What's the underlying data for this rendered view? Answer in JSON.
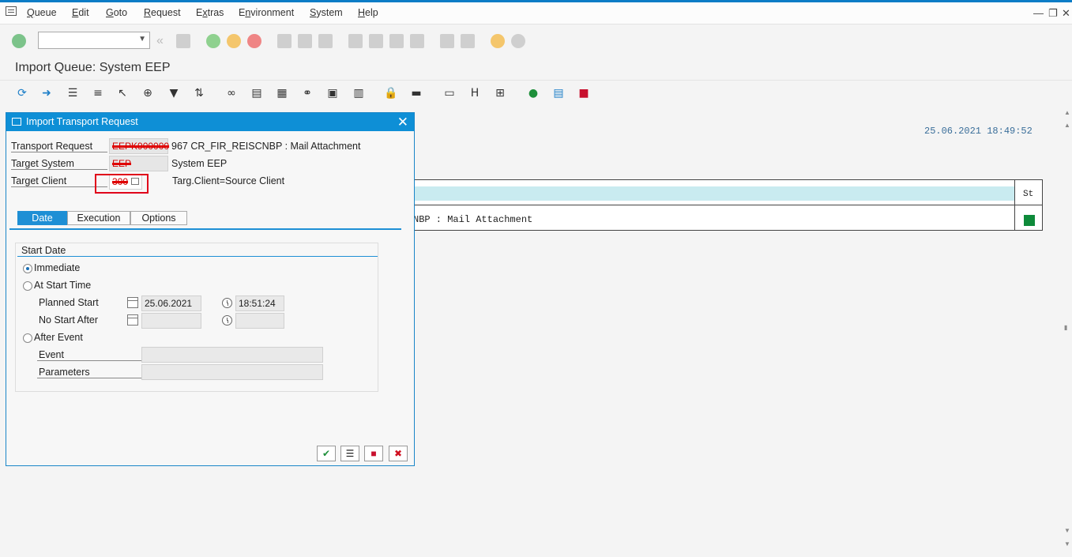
{
  "menubar": {
    "items": [
      "Queue",
      "Edit",
      "Goto",
      "Request",
      "Extras",
      "Environment",
      "System",
      "Help"
    ],
    "underlined": [
      "Q",
      "E",
      "G",
      "R",
      "x",
      "n",
      "S",
      "H"
    ]
  },
  "window": {
    "minimize": "—",
    "restore": "❐",
    "close": "✕"
  },
  "page": {
    "title": "Import Queue: System EEP"
  },
  "background": {
    "datetime": "25.06.2021 18:49:52",
    "col_status": "St",
    "row_text": "NBP : Mail Attachment",
    "status_color": "#0e8a3a"
  },
  "dialog": {
    "title": "Import Transport Request",
    "close": "✕",
    "fields": {
      "transport_request_label": "Transport Request",
      "transport_request_value": "EEPK900000",
      "transport_request_desc": "967 CR_FIR_REISCNBP : Mail Attachment",
      "target_system_label": "Target System",
      "target_system_value": "EEP",
      "target_system_desc": "System EEP",
      "target_client_label": "Target Client",
      "target_client_value": "300",
      "target_client_desc": "Targ.Client=Source Client"
    },
    "tabs": [
      "Date",
      "Execution",
      "Options"
    ],
    "start_date": {
      "group_title": "Start Date",
      "immediate": "Immediate",
      "at_start_time": "At Start Time",
      "planned_start_label": "Planned Start",
      "planned_start_date": "25.06.2021",
      "planned_start_time": "18:51:24",
      "no_start_after_label": "No Start After",
      "after_event": "After Event",
      "event_label": "Event",
      "parameters_label": "Parameters",
      "selected": "immediate"
    }
  },
  "colors": {
    "accent": "#0e8fd6",
    "highlight": "#e0001a"
  }
}
